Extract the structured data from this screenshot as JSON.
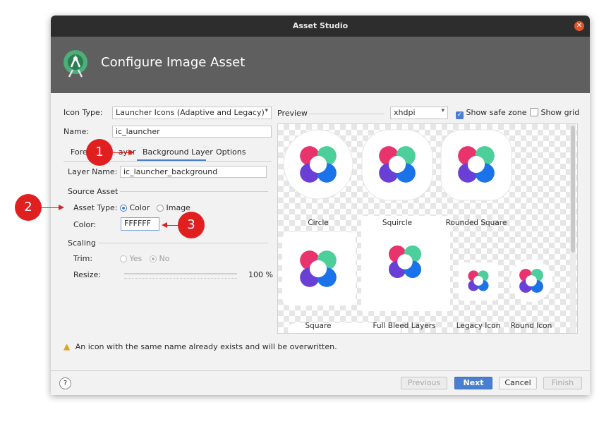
{
  "window": {
    "title": "Asset Studio",
    "header_title": "Configure Image Asset"
  },
  "form": {
    "icon_type_label": "Icon Type:",
    "icon_type_value": "Launcher Icons (Adaptive and Legacy)",
    "name_label": "Name:",
    "name_value": "ic_launcher",
    "tabs": [
      "Foreground Layer",
      "Background Layer",
      "Options"
    ],
    "tab_foreground_visible": "Fore",
    "tab_foreground_tail": "ayer",
    "active_tab": "Background Layer",
    "layer_name_label": "Layer Name:",
    "layer_name_value": "ic_launcher_background",
    "source_asset_header": "Source Asset",
    "asset_type_label": "Asset Type:",
    "asset_type_color": "Color",
    "asset_type_image": "Image",
    "color_label": "Color:",
    "color_value": "FFFFFF",
    "scaling_header": "Scaling",
    "trim_label": "Trim:",
    "trim_yes": "Yes",
    "trim_no": "No",
    "resize_label": "Resize:",
    "resize_value": "100 %",
    "resize_level": 1.0
  },
  "preview": {
    "label": "Preview",
    "density": "xhdpi",
    "show_safe_zone": "Show safe zone",
    "show_safe_zone_checked": true,
    "show_grid": "Show grid",
    "show_grid_checked": false,
    "items": [
      "Circle",
      "Squircle",
      "Rounded Square",
      "Square",
      "Full Bleed Layers",
      "Legacy Icon",
      "Round Icon"
    ]
  },
  "warning": "An icon with the same name already exists and will be overwritten.",
  "buttons": {
    "help": "?",
    "previous": "Previous",
    "next": "Next",
    "cancel": "Cancel",
    "finish": "Finish"
  },
  "callouts": [
    "1",
    "2",
    "3"
  ],
  "colors": {
    "accent": "#4a7fd0",
    "header": "#5f5f5f",
    "callout": "#e02020",
    "petal_pink": "#e8336d",
    "petal_green": "#4ccf9a",
    "petal_purple": "#6a3fd6",
    "petal_blue": "#1a73e8"
  }
}
